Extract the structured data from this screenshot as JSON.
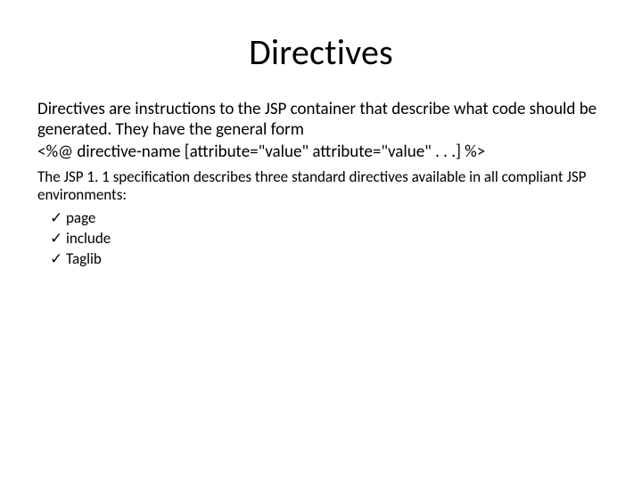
{
  "title": "Directives",
  "para1": "Directives are instructions to the JSP container that describe what code should be generated. They have the general form",
  "code_line": "<%@ directive-name [attribute=\"value\" attribute=\"value\" . . .] %>",
  "para2": "The JSP 1. 1 specification describes three standard directives available in all compliant JSP environments:",
  "check_mark": "✓",
  "items": [
    "page",
    "include",
    "Taglib"
  ]
}
